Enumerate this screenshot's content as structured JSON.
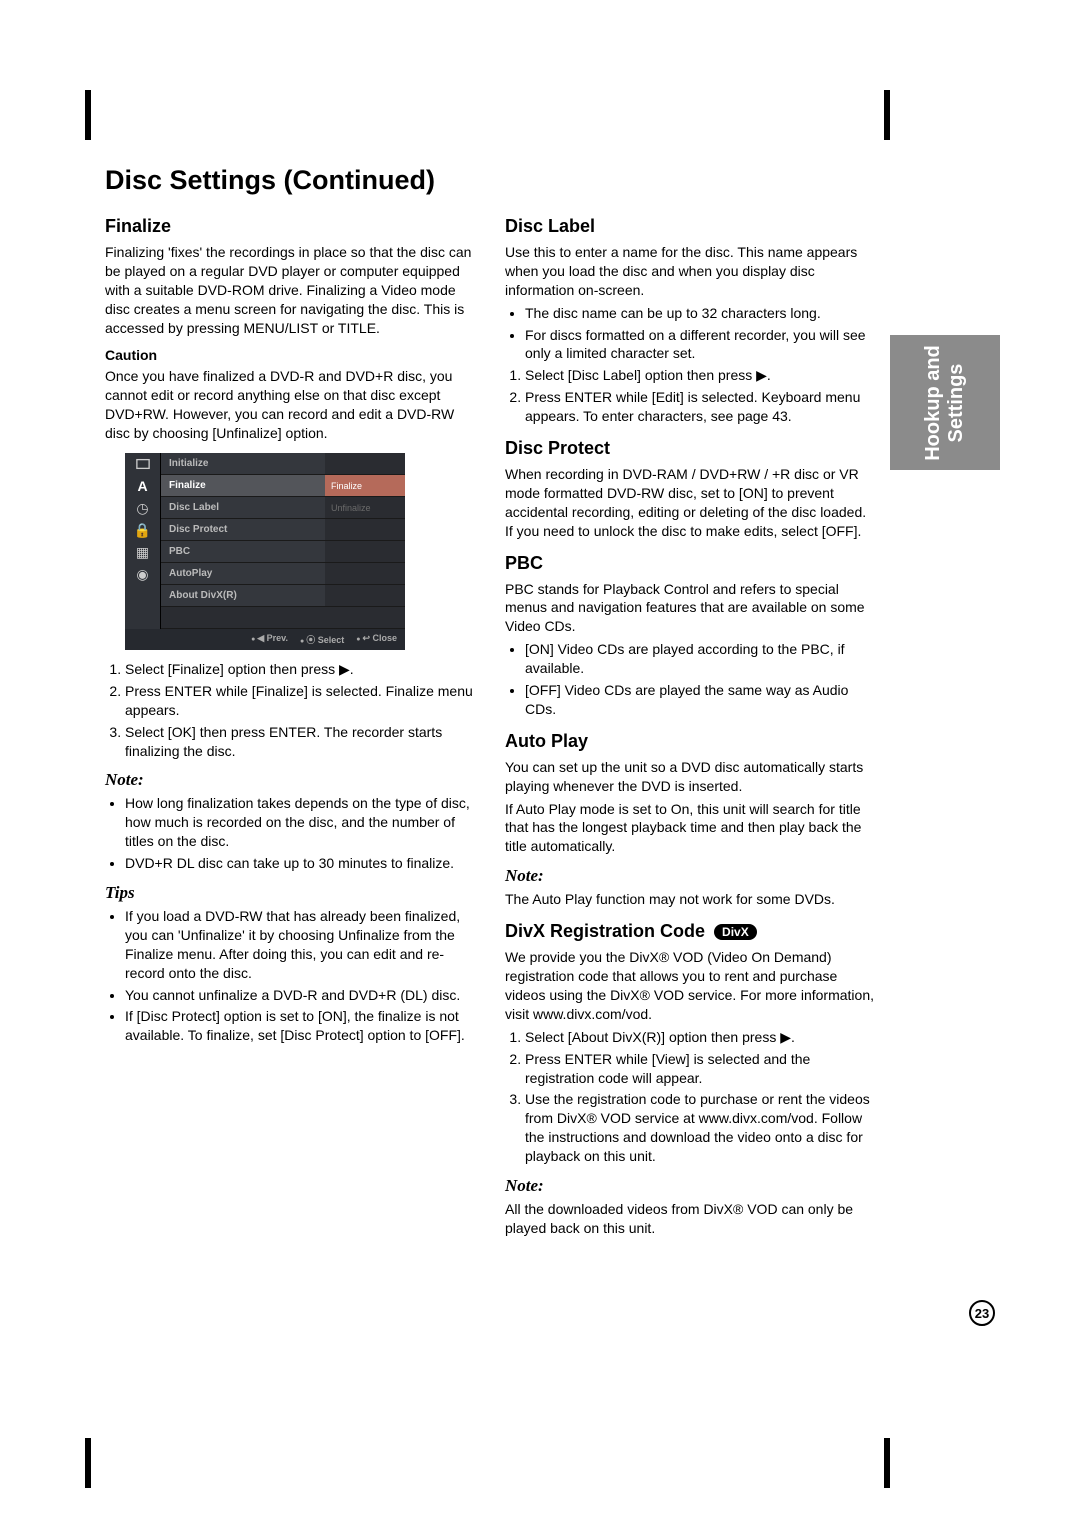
{
  "page_number": "23",
  "side_tab_line1": "Hookup and",
  "side_tab_line2": "Settings",
  "title": "Disc Settings (Continued)",
  "left": {
    "finalize": {
      "heading": "Finalize",
      "intro": "Finalizing 'fixes' the recordings in place so that the disc can be played on a regular DVD player or computer equipped with a suitable DVD-ROM drive. Finalizing a Video mode disc creates a menu screen for navigating the disc. This is accessed by pressing MENU/LIST or TITLE.",
      "caution_label": "Caution",
      "caution_text": "Once you have finalized a DVD-R and DVD+R disc, you cannot edit or record anything else on that disc except DVD+RW. However, you can record and edit a DVD-RW disc by choosing [Unfinalize] option.",
      "steps": [
        "Select [Finalize] option then press ▶.",
        "Press ENTER while [Finalize] is selected. Finalize menu appears.",
        "Select [OK] then press ENTER. The recorder starts finalizing the disc."
      ],
      "note_label": "Note:",
      "notes": [
        "How long finalization takes depends on the type of disc, how much is recorded on the disc, and the number of titles on the disc.",
        "DVD+R DL disc can take up to 30 minutes to finalize."
      ],
      "tips_label": "Tips",
      "tips": [
        "If you load a DVD-RW that has already been finalized, you can 'Unfinalize' it by choosing Unfinalize from the Finalize menu. After doing this, you can edit and re-record onto the disc.",
        "You cannot unfinalize a DVD-R and DVD+R (DL) disc.",
        "If [Disc Protect] option is set to [ON], the finalize is not available. To finalize, set [Disc Protect] option to [OFF]."
      ]
    },
    "osd": {
      "rows": [
        {
          "icon": "tv",
          "label": "Initialize",
          "value": ""
        },
        {
          "icon": "A",
          "label": "Finalize",
          "value": "Finalize",
          "selected": true
        },
        {
          "icon": "clock",
          "label": "Disc Label",
          "value": "Unfinalize"
        },
        {
          "icon": "lock",
          "label": "Disc Protect",
          "value": ""
        },
        {
          "icon": "film",
          "label": "PBC",
          "value": ""
        },
        {
          "icon": "disc",
          "label": "AutoPlay",
          "value": ""
        },
        {
          "icon": "",
          "label": "About DivX(R)",
          "value": ""
        }
      ],
      "footer": [
        "◀ Prev.",
        "⦿ Select",
        "↩ Close"
      ]
    }
  },
  "right": {
    "disc_label": {
      "heading": "Disc Label",
      "intro": "Use this to enter a name for the disc. This name appears when you load the disc and when you display disc information on-screen.",
      "bullets": [
        "The disc name can be up to 32 characters long.",
        "For discs formatted on a different recorder, you will see only a limited character set."
      ],
      "steps": [
        "Select [Disc Label] option then press ▶.",
        "Press ENTER while [Edit] is selected. Keyboard menu appears. To enter characters, see page 43."
      ]
    },
    "disc_protect": {
      "heading": "Disc Protect",
      "text": "When recording in DVD-RAM / DVD+RW / +R disc or VR mode formatted DVD-RW disc, set to [ON] to prevent accidental recording, editing or deleting of the disc loaded. If you need to unlock the disc to make edits, select [OFF]."
    },
    "pbc": {
      "heading": "PBC",
      "intro": "PBC stands for Playback Control and refers to special menus and navigation features that are available on some Video CDs.",
      "bullets": [
        "[ON] Video CDs are played according to the PBC, if available.",
        "[OFF] Video CDs are played the same way as Audio CDs."
      ]
    },
    "auto_play": {
      "heading": "Auto Play",
      "p1": "You can set up the unit so a DVD disc automatically starts playing whenever the DVD is inserted.",
      "p2": "If Auto Play mode is set to On, this unit will search for title that has the longest playback time and then play back the title automatically.",
      "note_label": "Note:",
      "note": "The Auto Play function may not work for some DVDs."
    },
    "divx": {
      "heading": "DivX Registration Code",
      "badge": "DivX",
      "intro": "We provide you the DivX® VOD (Video On Demand) registration code that allows you to rent and purchase videos using the DivX® VOD service. For more information, visit www.divx.com/vod.",
      "steps": [
        "Select [About DivX(R)] option then press ▶.",
        "Press ENTER while [View] is selected and the registration code will appear.",
        "Use the registration code to purchase or rent the videos from DivX® VOD service at www.divx.com/vod. Follow the instructions and download the video onto a disc for playback on this unit."
      ],
      "note_label": "Note:",
      "note": "All the downloaded videos from DivX® VOD can only be played back on this unit."
    }
  }
}
